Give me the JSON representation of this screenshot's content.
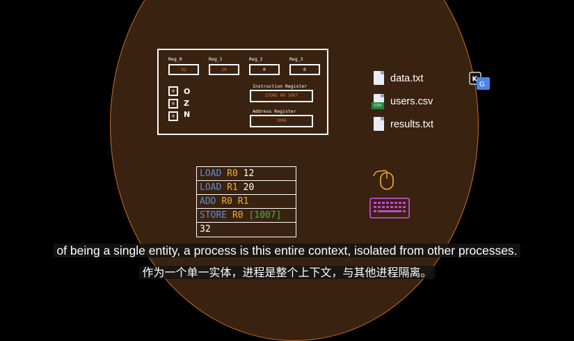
{
  "registers": [
    {
      "label": "Reg_0",
      "value": "32"
    },
    {
      "label": "Reg_1",
      "value": "20"
    },
    {
      "label": "Reg_2",
      "value": "0"
    },
    {
      "label": "Reg_3",
      "value": "0"
    }
  ],
  "flags": [
    {
      "value": "0",
      "letter": "O"
    },
    {
      "value": "0",
      "letter": "Z"
    },
    {
      "value": "0",
      "letter": "N"
    }
  ],
  "instruction_register": {
    "label": "Instruction Register",
    "value": "STORE R0 1007"
  },
  "address_register": {
    "label": "Address Register",
    "value": "1006"
  },
  "files": [
    {
      "name": "data.txt",
      "icon": "text-file-icon"
    },
    {
      "name": "users.csv",
      "icon": "csv-file-icon",
      "tag": "CSV"
    },
    {
      "name": "results.txt",
      "icon": "text-file-icon"
    }
  ],
  "code": {
    "line1": {
      "op": "LOAD",
      "reg": "R0",
      "arg": "12"
    },
    "line2": {
      "op": "LOAD",
      "reg": "R1",
      "arg": "20"
    },
    "line3": {
      "op": "ADD",
      "reg": "R0",
      "arg": "R1"
    },
    "line4": {
      "op": "STORE",
      "reg": "R0",
      "arg": "[1007]"
    },
    "line5": {
      "value": "32"
    }
  },
  "captions": {
    "english": "of being a single entity, a process is this entire context, isolated from other processes.",
    "chinese": "作为一个单一实体，进程是整个上下文，与其他进程隔离。"
  },
  "colors": {
    "background": "#000000",
    "circle_fill": "#3a2210",
    "circle_border": "#c8702a",
    "register_value": "#e07a3a",
    "keyword": "#5b8fd6",
    "register_name": "#f0b030",
    "address": "#4caf50",
    "keyboard": "#c04ad0"
  }
}
